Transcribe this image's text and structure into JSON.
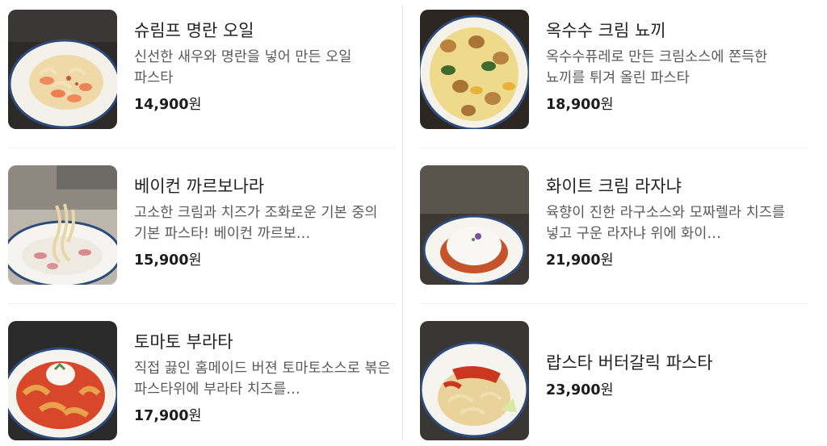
{
  "menu": {
    "left": [
      {
        "name": "슈림프 명란 오일",
        "desc": "신선한 새우와 명란을 넣어 만든 오일 파스타",
        "price": "14,900",
        "currency": "원",
        "image_icon": "shrimp-pasta-photo"
      },
      {
        "name": "베이컨 까르보나라",
        "desc": "고소한 크림과 치즈가 조화로운 기본 중의 기본 파스타! 베이컨 까르보…",
        "price": "15,900",
        "currency": "원",
        "image_icon": "carbonara-photo"
      },
      {
        "name": "토마토 부라타",
        "desc": "직접 끓인 홈메이드 버젼 토마토소스로 볶은 파스타위에 부라타 치즈를…",
        "price": "17,900",
        "currency": "원",
        "image_icon": "tomato-burrata-photo"
      }
    ],
    "right": [
      {
        "name": "옥수수 크림 뇨끼",
        "desc": "옥수수퓨레로 만든 크림소스에 쫀득한 뇨끼를 튀겨 올린 파스타",
        "price": "18,900",
        "currency": "원",
        "image_icon": "corn-gnocchi-photo"
      },
      {
        "name": "화이트 크림 라자냐",
        "desc": "육향이 진한 라구소스와 모짜렐라 치즈를 넣고 구운 라자냐 위에 화이…",
        "price": "21,900",
        "currency": "원",
        "image_icon": "lasagna-photo"
      },
      {
        "name": "랍스타 버터갈릭 파스타",
        "desc": "",
        "price": "23,900",
        "currency": "원",
        "image_icon": "lobster-pasta-photo"
      }
    ]
  }
}
